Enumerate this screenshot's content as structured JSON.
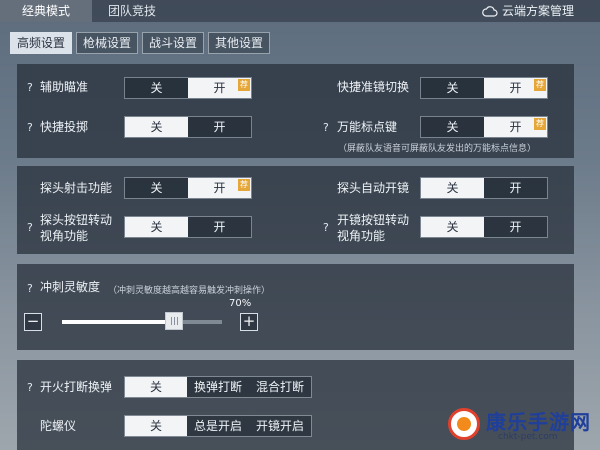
{
  "top_tabs": [
    "经典模式",
    "团队竞技"
  ],
  "cloud_manage": "云端方案管理",
  "sub_tabs": [
    "高频设置",
    "枪械设置",
    "战斗设置",
    "其他设置"
  ],
  "active_sub_tab": 0,
  "q_mark": "?",
  "toggle": {
    "off": "关",
    "on": "开",
    "recommend": "荐"
  },
  "settings": {
    "aim_assist": {
      "label": "辅助瞄准",
      "state": "开",
      "recommended": true
    },
    "quick_scope_switch": {
      "label": "快捷准镜切换",
      "state": "开",
      "recommended": true
    },
    "quick_throw": {
      "label": "快捷投掷",
      "state": "关"
    },
    "universal_mark_key": {
      "label": "万能标点键",
      "state": "开",
      "recommended": true,
      "note": "（屏蔽队友语音可屏蔽队友发出的万能标点信息）"
    },
    "peek_fire": {
      "label": "探头射击功能",
      "state": "开",
      "recommended": true
    },
    "peek_auto_scope": {
      "label": "探头自动开镜",
      "state": "关"
    },
    "peek_button_turn": {
      "label_line1": "探头按钮转动",
      "label_line2": "视角功能",
      "state": "关"
    },
    "scope_button_turn": {
      "label_line1": "开镜按钮转动",
      "label_line2": "视角功能",
      "state": "关"
    }
  },
  "sprint_sensitivity": {
    "label": "冲刺灵敏度",
    "note": "（冲刺灵敏度越高越容易触发冲刺操作）",
    "value_percent": 70,
    "value_text": "70%",
    "minus": "−",
    "plus": "+"
  },
  "fire_interrupt_reload": {
    "label": "开火打断换弹",
    "options": [
      "关",
      "换弹打断",
      "混合打断"
    ],
    "selected": 0
  },
  "gyroscope": {
    "label": "陀螺仪",
    "options": [
      "关",
      "总是开启",
      "开镜开启"
    ],
    "selected": 0
  },
  "watermark": {
    "title": "康乐手游网",
    "url": "chkt-pet.com"
  },
  "colors": {
    "recommend_badge": "#e5a73a",
    "selected_option": "#f2f4f6",
    "panel_bg": "#262e39"
  }
}
